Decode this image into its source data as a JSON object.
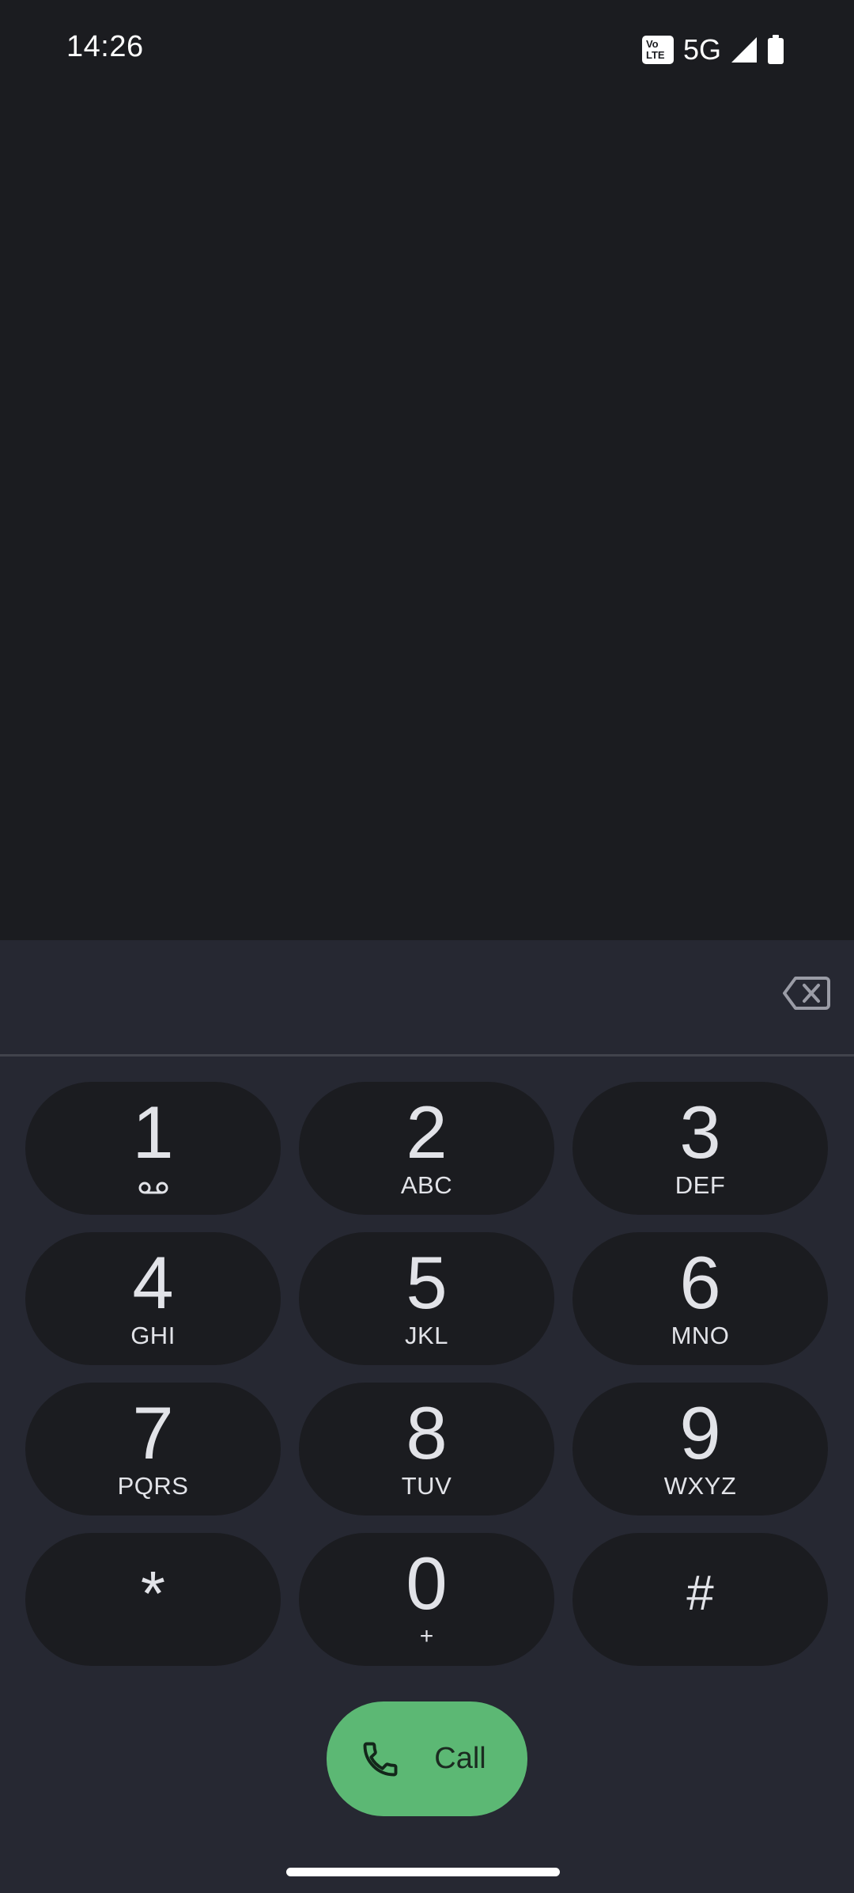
{
  "status_bar": {
    "time": "14:26",
    "volte_top": "Vo",
    "volte_bottom": "LTE",
    "network": "5G",
    "icons": [
      "signal-icon",
      "battery-icon"
    ]
  },
  "dialer": {
    "number": "",
    "keys": [
      {
        "digit": "1",
        "letters": "",
        "icon": "voicemail-icon"
      },
      {
        "digit": "2",
        "letters": "ABC"
      },
      {
        "digit": "3",
        "letters": "DEF"
      },
      {
        "digit": "4",
        "letters": "GHI"
      },
      {
        "digit": "5",
        "letters": "JKL"
      },
      {
        "digit": "6",
        "letters": "MNO"
      },
      {
        "digit": "7",
        "letters": "PQRS"
      },
      {
        "digit": "8",
        "letters": "TUV"
      },
      {
        "digit": "9",
        "letters": "WXYZ"
      },
      {
        "digit": "*",
        "letters": ""
      },
      {
        "digit": "0",
        "letters": "+"
      },
      {
        "digit": "#",
        "letters": ""
      }
    ],
    "call_label": "Call",
    "call_color": "#5cb874",
    "background": "#1b1c20",
    "panel_background": "#262832"
  }
}
